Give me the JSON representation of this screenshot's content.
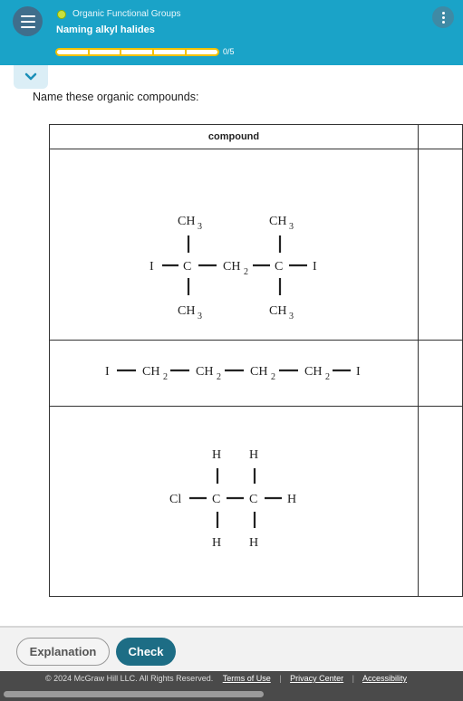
{
  "header": {
    "topic": "Organic Functional Groups",
    "subtitle": "Naming alkyl halides",
    "progress_text": "0/5",
    "progress_value": 0,
    "progress_segments": 5
  },
  "prompt": "Name these organic compounds:",
  "table": {
    "column_header": "compound",
    "name_header": ""
  },
  "compound1": {
    "ch3": "CH",
    "sub3": "3",
    "c": "C",
    "i": "I",
    "ch2": "CH",
    "sub2": "2"
  },
  "compound2": {
    "i": "I",
    "ch2": "CH",
    "sub2": "2"
  },
  "compound3": {
    "cl": "Cl",
    "c": "C",
    "h": "H"
  },
  "footer": {
    "explanation": "Explanation",
    "check": "Check",
    "copyright": "© 2024 McGraw Hill LLC. All Rights Reserved.",
    "terms": "Terms of Use",
    "privacy": "Privacy Center",
    "accessibility": "Accessibility",
    "separator": "|"
  },
  "colors": {
    "header": "#1aa3c8",
    "check_button": "#1d6d85",
    "progress_border": "#f2c100"
  }
}
